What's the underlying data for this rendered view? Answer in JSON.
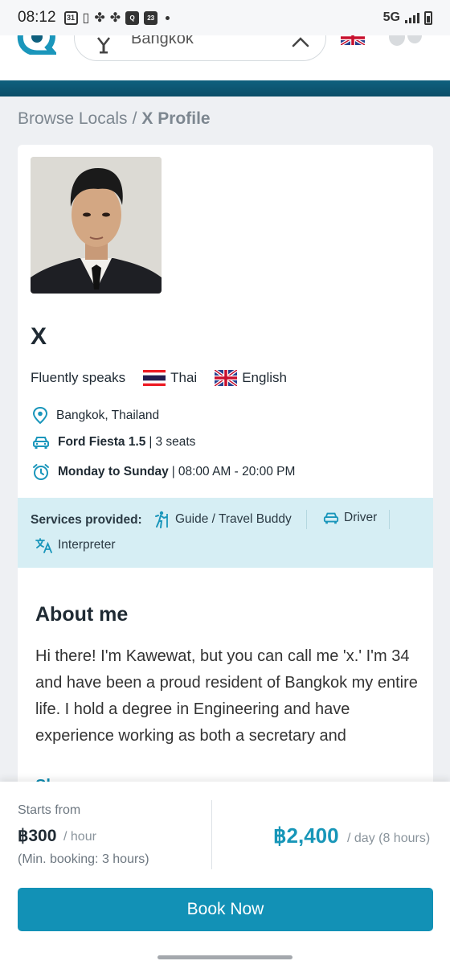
{
  "status_bar": {
    "time": "08:12",
    "calendar_badge": "31",
    "calendar_badge_2": "23",
    "app_badge": "Q",
    "network": "5G"
  },
  "header": {
    "search_value": "Bangkok",
    "icons": [
      "logo-icon",
      "search-pin-icon",
      "clear-icon",
      "uk-flag-icon",
      "user-icon"
    ]
  },
  "breadcrumb": {
    "parent": "Browse Locals",
    "separator": "/",
    "current": "X Profile"
  },
  "profile": {
    "name": "X",
    "speaks_label": "Fluently speaks",
    "languages": [
      "Thai",
      "English"
    ],
    "location": "Bangkok, Thailand",
    "car_model": "Ford Fiesta 1.5",
    "car_seats": "3 seats",
    "availability_days": "Monday to Sunday",
    "availability_hours": "08:00 AM - 20:00 PM",
    "separator": "|"
  },
  "services": {
    "label": "Services provided:",
    "items": [
      "Guide / Travel Buddy",
      "Driver",
      "Interpreter"
    ]
  },
  "about": {
    "title": "About me",
    "text": "Hi there! I'm Kawewat, but you can call me 'x.' I'm 34 and have been a proud resident of Bangkok my entire life. I hold a degree in Engineering and have experience working as both a secretary and",
    "show_more": "Sh"
  },
  "booking": {
    "starts_from": "Starts from",
    "hour_price": "฿300",
    "hour_unit": "/ hour",
    "min_booking": "(Min. booking: 3 hours)",
    "day_price": "฿2,400",
    "day_unit": "/ day (8 hours)",
    "button_label": "Book Now"
  },
  "colors": {
    "accent": "#1291b6",
    "banner": "#0f607e",
    "services_bg": "#d6eef4",
    "price": "#1796b8"
  }
}
